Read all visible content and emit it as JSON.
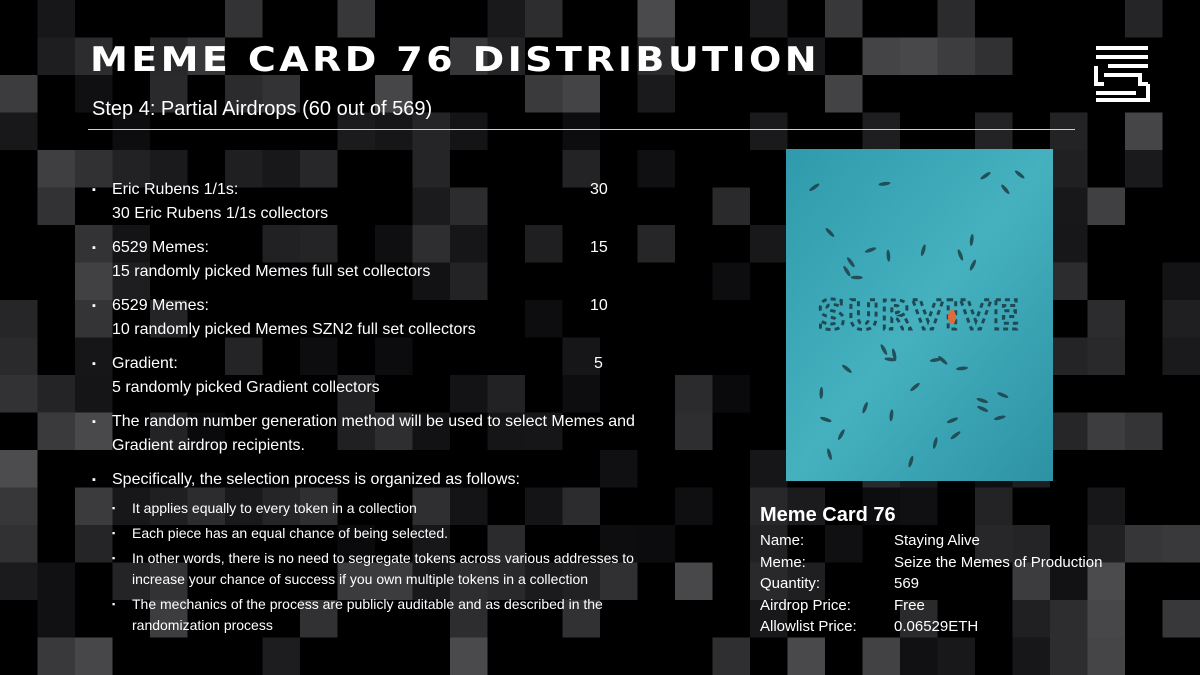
{
  "header": {
    "title": "MEME CARD 76 DISTRIBUTION",
    "subtitle": "Step 4:  Partial Airdrops (60 out of 569)"
  },
  "logo": {
    "icon": "seize-logo-icon"
  },
  "bullets": [
    {
      "line1": "Eric Rubens 1/1s:",
      "line2": "30 Eric Rubens 1/1s collectors",
      "count": "30"
    },
    {
      "line1": "6529 Memes:",
      "line2": "15 randomly picked Memes full set collectors",
      "count": "15"
    },
    {
      "line1": "6529 Memes:",
      "line2": "10 randomly picked Memes SZN2 full set collectors",
      "count": "10"
    },
    {
      "line1": "Gradient:",
      "line2": "5 randomly picked Gradient collectors",
      "count": "5"
    },
    {
      "line1": "The random number generation method will be used to select Memes and",
      "line2": "Gradient airdrop recipients."
    },
    {
      "line1": "Specifically, the selection process is organized as follows:"
    }
  ],
  "sub_bullets": [
    {
      "line1": "It applies equally to every token in a collection"
    },
    {
      "line1": "Each piece has an equal chance of being selected."
    },
    {
      "line1": "In other words, there is no need to segregate tokens across various addresses to",
      "line2": "increase your chance of success if you own multiple tokens in a collection"
    },
    {
      "line1": "The mechanics of the process are publicly auditable and as described in the",
      "line2": "randomization process"
    }
  ],
  "artwork": {
    "text": "SURVIVE",
    "water_color": "#3aa4b3"
  },
  "card": {
    "title": "Meme Card 76",
    "rows": [
      {
        "label": "Name:",
        "value": "Staying Alive"
      },
      {
        "label": "Meme:",
        "value": "Seize the Memes of Production"
      },
      {
        "label": "Quantity:",
        "value": "569"
      },
      {
        "label": "Airdrop Price:",
        "value": "Free"
      },
      {
        "label": "Allowlist Price:",
        "value": "0.06529ETH"
      }
    ]
  }
}
